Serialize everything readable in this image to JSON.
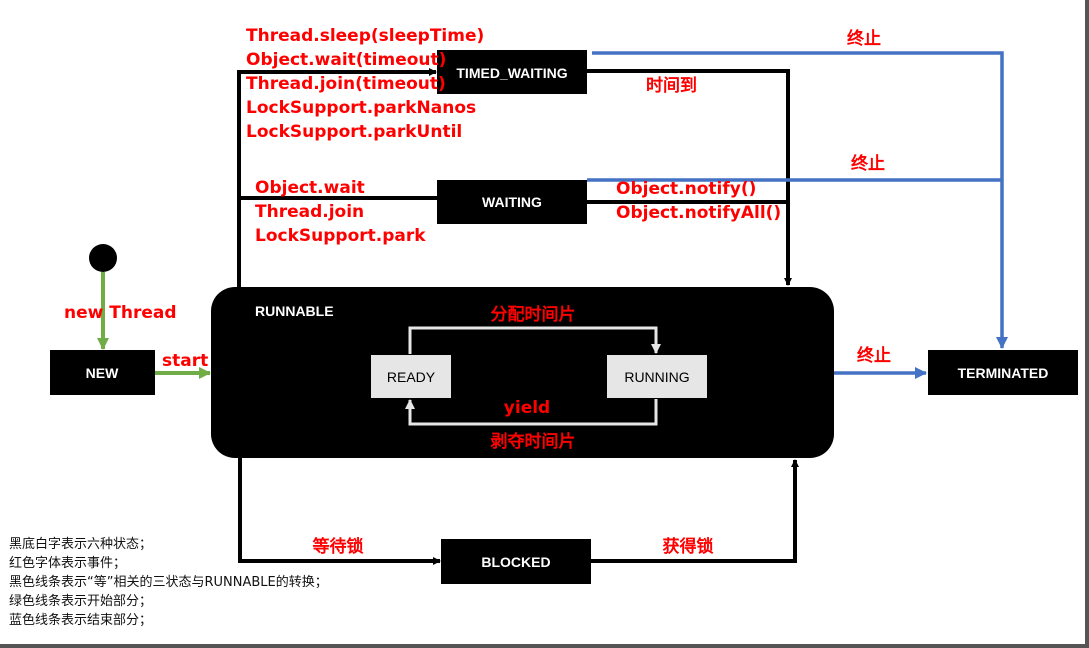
{
  "states": {
    "new": "NEW",
    "runnable": "RUNNABLE",
    "ready": "READY",
    "running": "RUNNING",
    "timed_waiting": "TIMED_WAITING",
    "waiting": "WAITING",
    "blocked": "BLOCKED",
    "terminated": "TERMINATED"
  },
  "events": {
    "new_thread": "new Thread",
    "start": "start",
    "timed_waiting_entry": [
      "Thread.sleep(sleepTime)",
      "Object.wait(timeout)",
      "Thread.join(timeout)",
      "LockSupport.parkNanos",
      "LockSupport.parkUntil"
    ],
    "time_up": "时间到",
    "waiting_entry": [
      "Object.wait",
      "Thread.join",
      "LockSupport.park"
    ],
    "waiting_exit": [
      "Object.notify()",
      "Object.notifyAll()"
    ],
    "allocate_slice": "分配时间片",
    "yield": "yield",
    "revoke_slice": "剥夺时间片",
    "wait_lock": "等待锁",
    "acquire_lock": "获得锁",
    "terminate_timed": "终止",
    "terminate_waiting": "终止",
    "terminate_runnable": "终止"
  },
  "colors": {
    "event_text": "#ff0000",
    "black_line": "#000000",
    "green_line": "#70ad47",
    "blue_line": "#4472c4",
    "inner_box": "#e7e6e6"
  },
  "legend": [
    "黑底白字表示六种状态；",
    "红色字体表示事件；",
    "黑色线条表示“等”相关的三状态与RUNNABLE的转换；",
    "绿色线条表示开始部分；",
    "蓝色线条表示结束部分；"
  ]
}
